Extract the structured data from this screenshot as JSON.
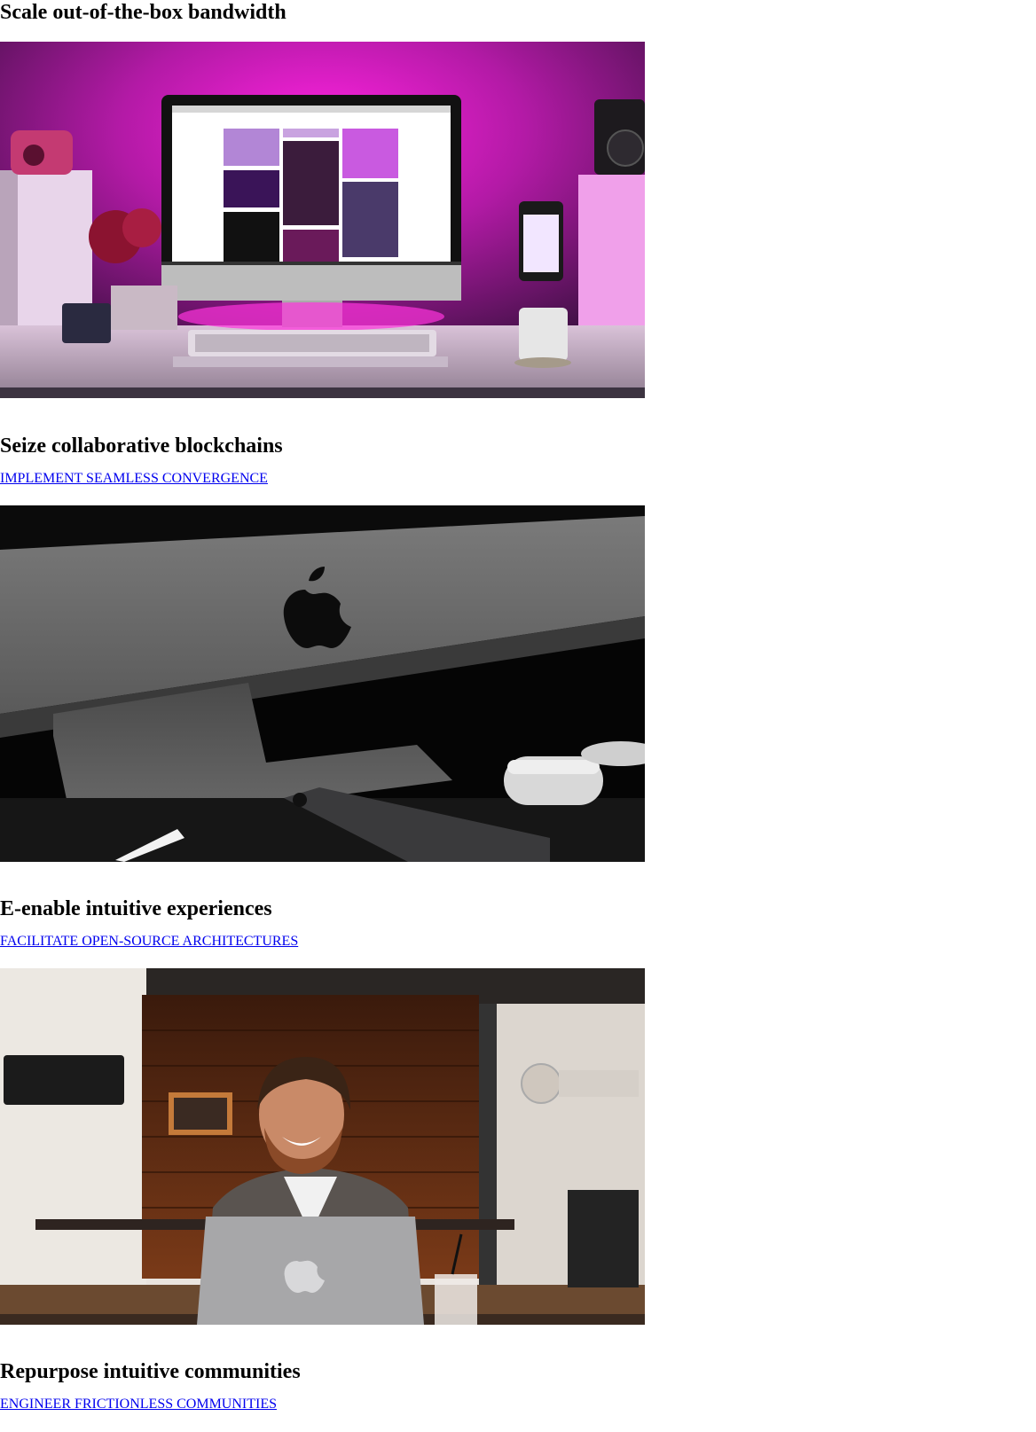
{
  "colors": {
    "link": "#0000ee",
    "heading": "#000000",
    "background": "#ffffff"
  },
  "sections": [
    {
      "heading": "Scale out-of-the-box bandwidth",
      "link": "",
      "image": "imac-desk-pink-light-photo"
    },
    {
      "heading": "Seize collaborative blockchains",
      "link": "IMPLEMENT SEAMLESS CONVERGENCE",
      "image": "imac-iphone-airpods-closeup-photo"
    },
    {
      "heading": "E-enable intuitive experiences",
      "link": "FACILITATE OPEN-SOURCE ARCHITECTURES",
      "image": "man-with-laptop-in-cafe-photo"
    },
    {
      "heading": "Repurpose intuitive communities",
      "link": "ENGINEER FRICTIONLESS COMMUNITIES",
      "image": ""
    }
  ]
}
